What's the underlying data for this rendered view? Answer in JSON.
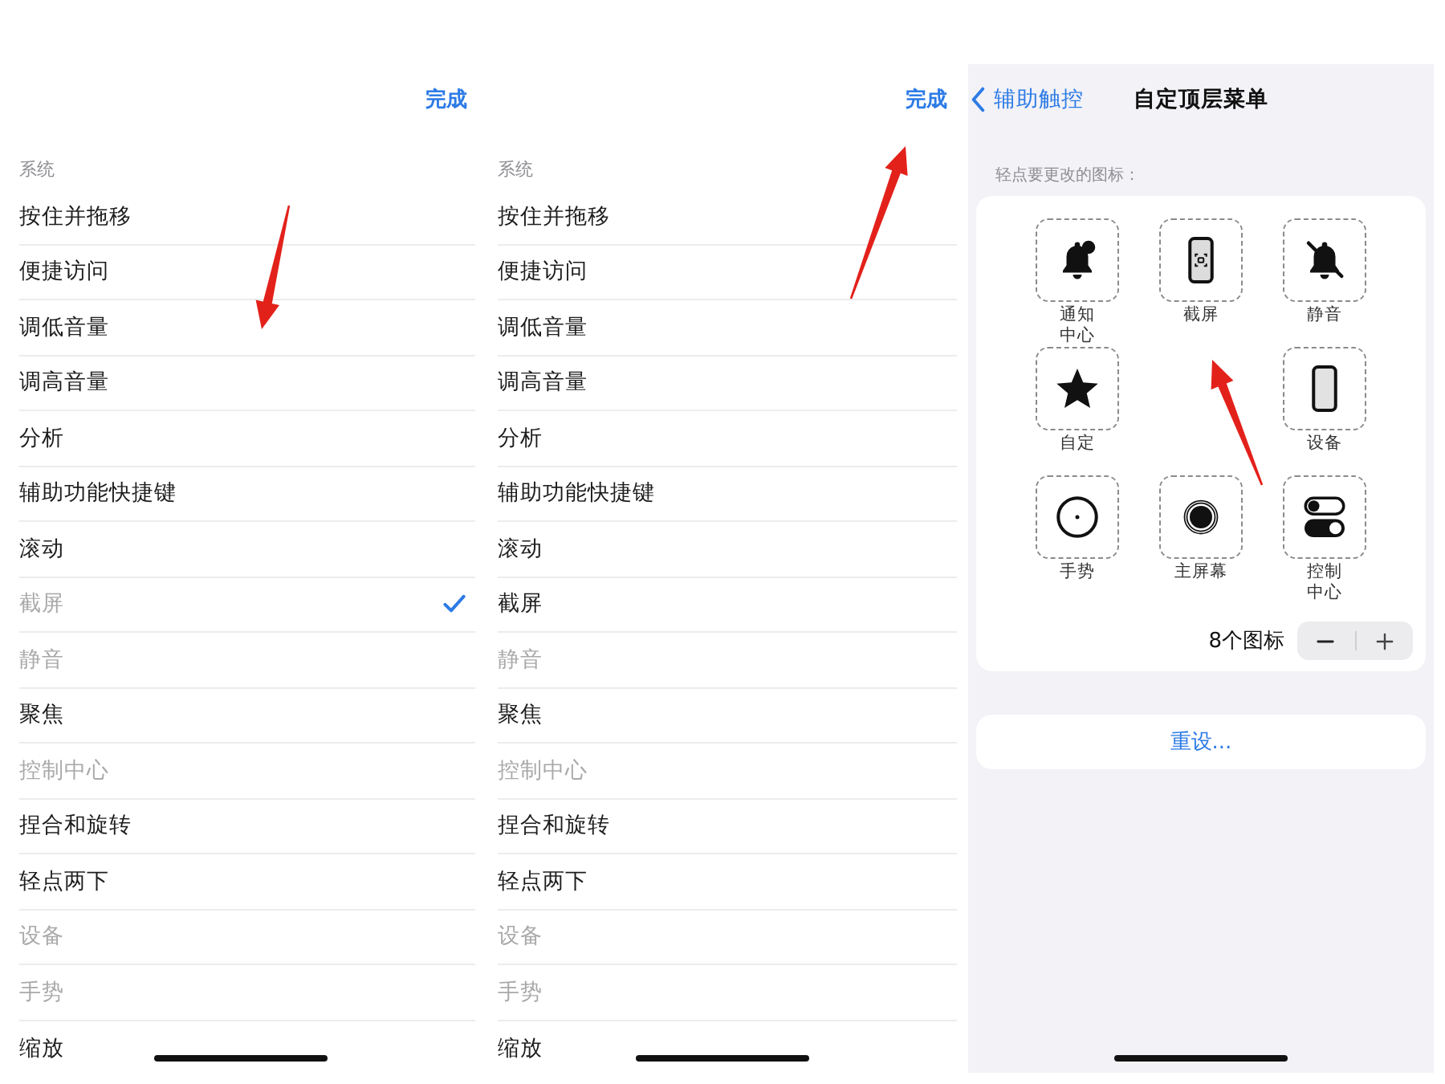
{
  "panels": [
    {
      "kind": "menu-list",
      "done": "完成",
      "section": "系统",
      "arrow": true,
      "rows": [
        {
          "label": "按住并拖移",
          "disabled": false,
          "selected": false
        },
        {
          "label": "便捷访问",
          "disabled": false,
          "selected": false
        },
        {
          "label": "调低音量",
          "disabled": false,
          "selected": false
        },
        {
          "label": "调高音量",
          "disabled": false,
          "selected": false
        },
        {
          "label": "分析",
          "disabled": false,
          "selected": false
        },
        {
          "label": "辅助功能快捷键",
          "disabled": false,
          "selected": false
        },
        {
          "label": "滚动",
          "disabled": false,
          "selected": false
        },
        {
          "label": "截屏",
          "disabled": true,
          "selected": true
        },
        {
          "label": "静音",
          "disabled": true,
          "selected": false
        },
        {
          "label": "聚焦",
          "disabled": false,
          "selected": false
        },
        {
          "label": "控制中心",
          "disabled": true,
          "selected": false
        },
        {
          "label": "捏合和旋转",
          "disabled": false,
          "selected": false
        },
        {
          "label": "轻点两下",
          "disabled": false,
          "selected": false
        },
        {
          "label": "设备",
          "disabled": true,
          "selected": false
        },
        {
          "label": "手势",
          "disabled": true,
          "selected": false
        },
        {
          "label": "缩放",
          "disabled": false,
          "selected": false
        }
      ]
    },
    {
      "kind": "menu-list",
      "done": "完成",
      "section": "系统",
      "arrow": true,
      "rows": [
        {
          "label": "按住并拖移",
          "disabled": false,
          "selected": false
        },
        {
          "label": "便捷访问",
          "disabled": false,
          "selected": false
        },
        {
          "label": "调低音量",
          "disabled": false,
          "selected": false
        },
        {
          "label": "调高音量",
          "disabled": false,
          "selected": false
        },
        {
          "label": "分析",
          "disabled": false,
          "selected": false
        },
        {
          "label": "辅助功能快捷键",
          "disabled": false,
          "selected": false
        },
        {
          "label": "滚动",
          "disabled": false,
          "selected": false
        },
        {
          "label": "截屏",
          "disabled": false,
          "selected": false
        },
        {
          "label": "静音",
          "disabled": true,
          "selected": false
        },
        {
          "label": "聚焦",
          "disabled": false,
          "selected": false
        },
        {
          "label": "控制中心",
          "disabled": true,
          "selected": false
        },
        {
          "label": "捏合和旋转",
          "disabled": false,
          "selected": false
        },
        {
          "label": "轻点两下",
          "disabled": false,
          "selected": false
        },
        {
          "label": "设备",
          "disabled": true,
          "selected": false
        },
        {
          "label": "手势",
          "disabled": true,
          "selected": false
        },
        {
          "label": "缩放",
          "disabled": false,
          "selected": false
        }
      ]
    },
    {
      "kind": "icon-grid",
      "back": "辅助触控",
      "title": "自定顶层菜单",
      "hint": "轻点要更改的图标：",
      "arrow": true,
      "tiles": [
        {
          "kind": "notification",
          "label": "通知中心"
        },
        {
          "kind": "screenshot",
          "label": "截屏"
        },
        {
          "kind": "mute",
          "label": "静音"
        },
        {
          "kind": "custom",
          "label": "自定"
        },
        {
          "kind": "device",
          "label": "设备"
        },
        {
          "kind": "gesture",
          "label": "手势"
        },
        {
          "kind": "home",
          "label": "主屏幕"
        },
        {
          "kind": "control",
          "label": "控制中心"
        }
      ],
      "count": "8个图标",
      "reset": "重设..."
    }
  ]
}
